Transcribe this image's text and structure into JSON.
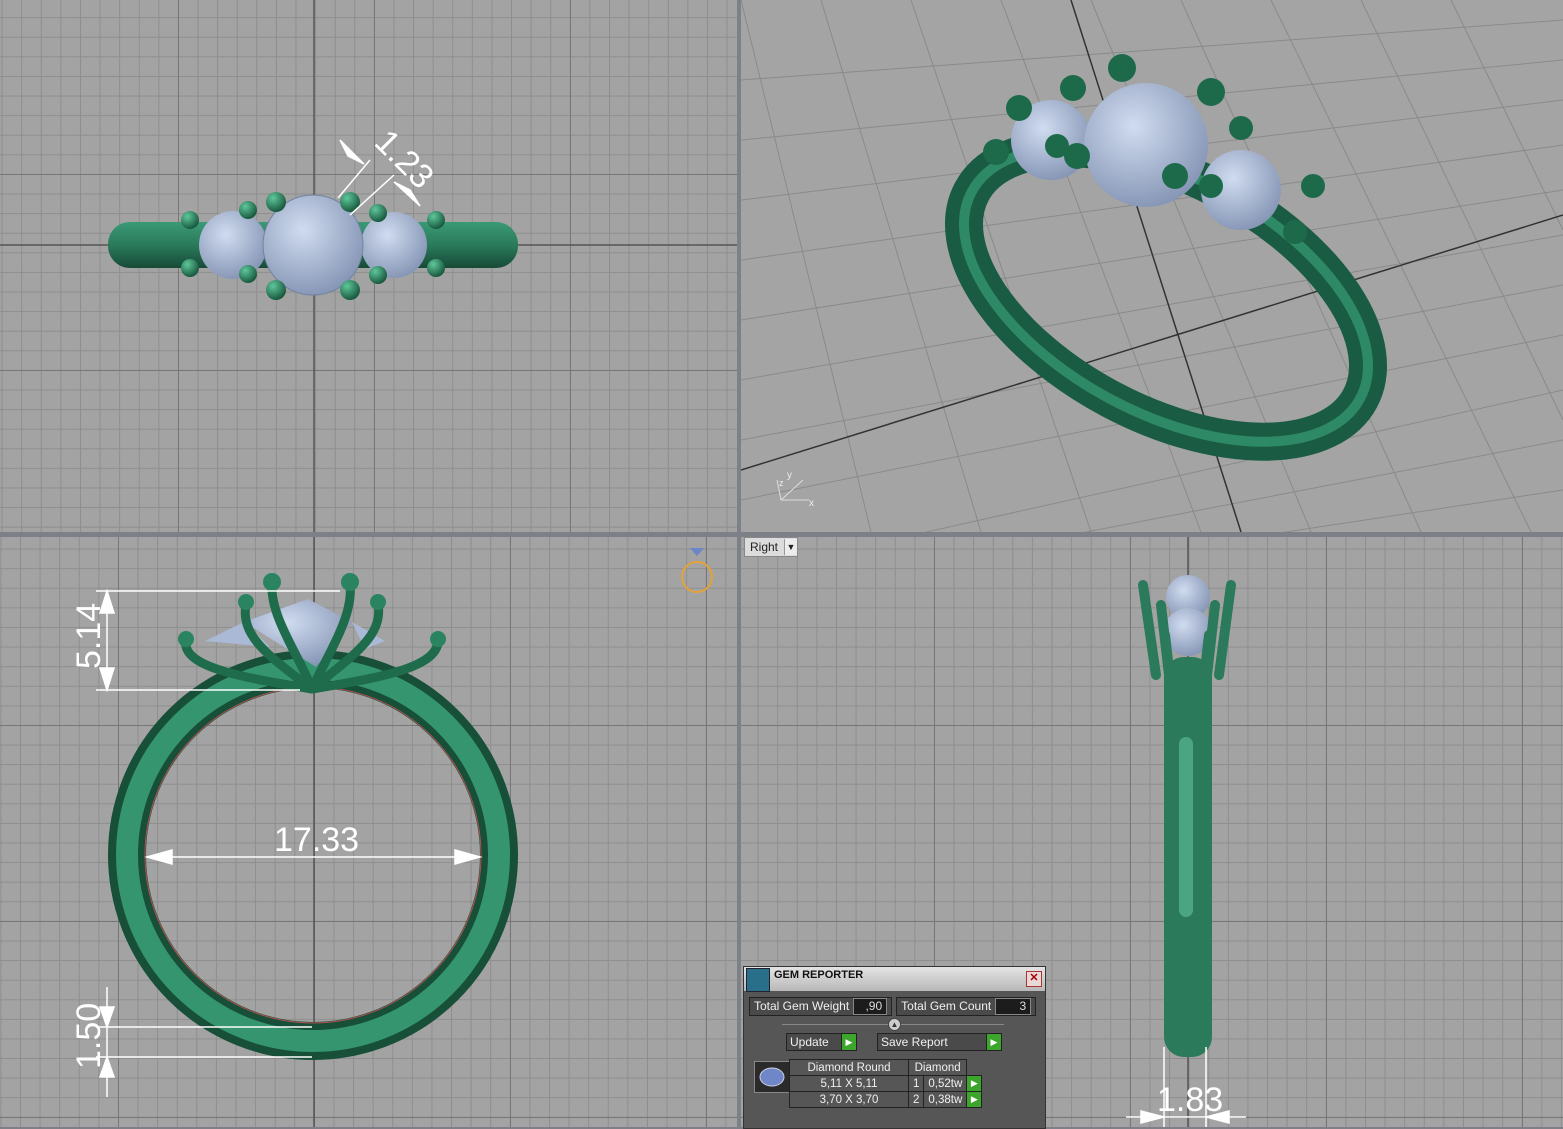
{
  "viewports": {
    "top": {
      "dimension": "1.23"
    },
    "front": {
      "dim_height": "5.14",
      "dim_inner": "17.33",
      "dim_band": "1.50"
    },
    "right": {
      "label": "Right",
      "dimension": "1.83"
    }
  },
  "gem_reporter": {
    "title": "GEM REPORTER",
    "total_weight_label": "Total Gem Weight",
    "total_weight_value": ",90",
    "total_count_label": "Total Gem Count",
    "total_count_value": "3",
    "update_label": "Update",
    "save_label": "Save Report",
    "table": {
      "headers": [
        "Diamond Round",
        "Diamond"
      ],
      "rows": [
        {
          "size": "5,11 X 5,11",
          "count": "1",
          "weight": "0,52tw"
        },
        {
          "size": "3,70 X 3,70",
          "count": "2",
          "weight": "0,38tw"
        }
      ]
    }
  },
  "colors": {
    "metal": "#2f8a68",
    "gem": "#a6b6d6",
    "background": "#a3a3a3"
  }
}
